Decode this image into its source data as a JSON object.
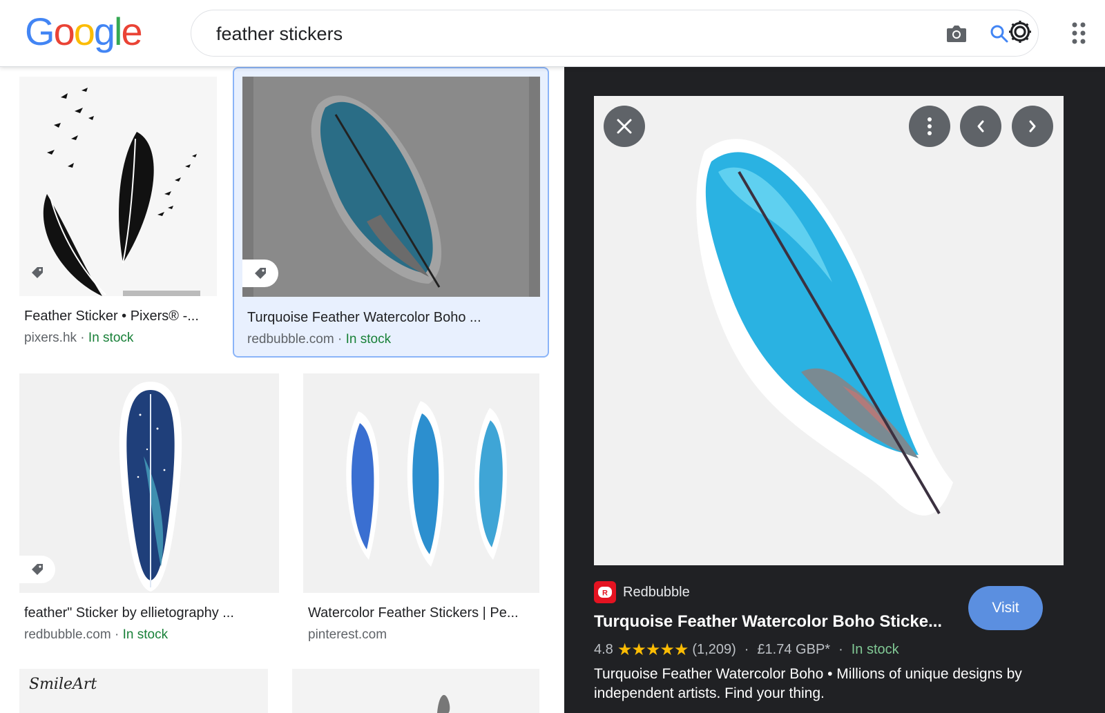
{
  "header": {
    "logo": [
      "G",
      "o",
      "o",
      "g",
      "l",
      "e"
    ],
    "logo_colors": [
      "#4285F4",
      "#EA4335",
      "#FBBC05",
      "#4285F4",
      "#34A853",
      "#EA4335"
    ],
    "search_value": "feather stickers",
    "camera_icon": "camera-icon",
    "search_icon": "search-icon",
    "settings_icon": "gear-icon",
    "apps_icon": "apps-grid-icon"
  },
  "results": [
    {
      "title": "Feather Sticker • Pixers® -...",
      "source": "pixers.hk",
      "separator": " · ",
      "stock": "In stock",
      "selected": false
    },
    {
      "title": "Turquoise Feather Watercolor Boho ...",
      "source": "redbubble.com",
      "separator": " · ",
      "stock": "In stock",
      "selected": true
    },
    {
      "title": "feather\" Sticker by ellietography ...",
      "source": "redbubble.com",
      "separator": " · ",
      "stock": "In stock",
      "selected": false
    },
    {
      "title": "Watercolor Feather Stickers | Pe...",
      "source": "pinterest.com",
      "separator": "",
      "stock": "",
      "selected": false
    },
    {
      "partial_text": "SmileArt"
    }
  ],
  "preview": {
    "source_name": "Redbubble",
    "title": "Turquoise Feather Watercolor Boho Sticke...",
    "rating": "4.8",
    "stars": "★★★★★",
    "reviews": "(1,209)",
    "price": "£1.74 GBP*",
    "dot": "·",
    "stock": "In stock",
    "description": "Turquoise Feather Watercolor Boho • Millions of unique designs by independent artists. Find your thing.",
    "visit_label": "Visit",
    "icons": [
      "close-icon",
      "more-vert-icon",
      "chevron-left-icon",
      "chevron-right-icon"
    ]
  },
  "colors": {
    "accent": "#1a73e8",
    "in_stock": "#188038",
    "panel_bg": "#202124",
    "star": "#fbbc04",
    "visit": "#5b8fe0",
    "selected_bg": "#e8f0fe"
  }
}
